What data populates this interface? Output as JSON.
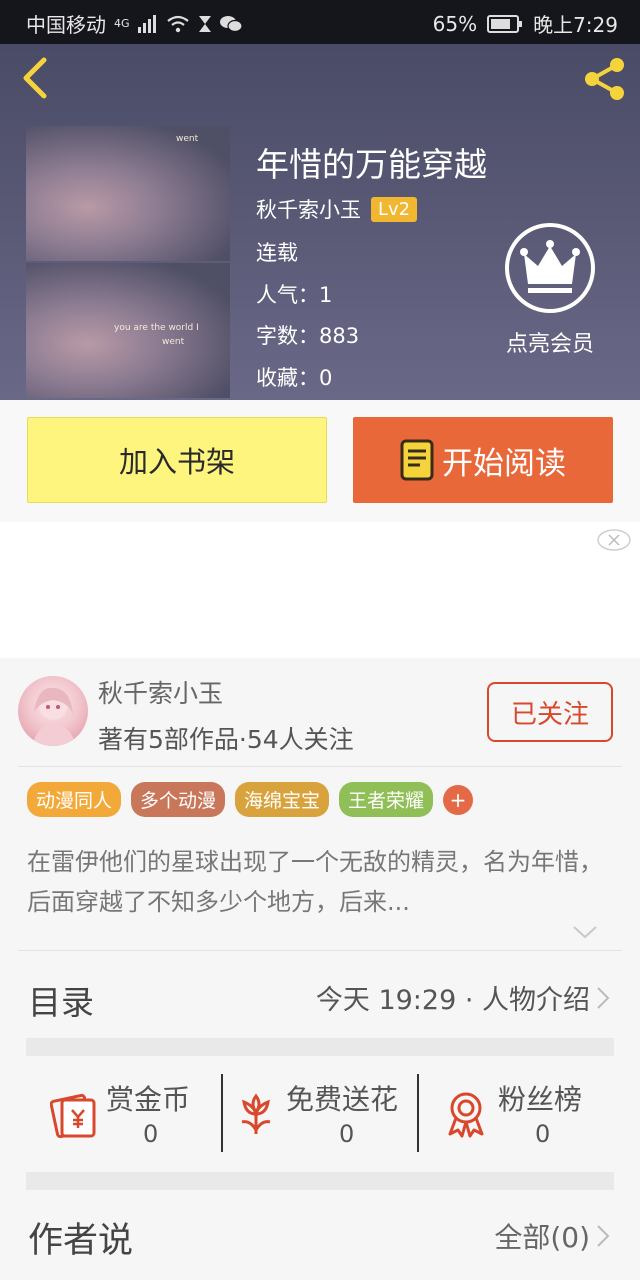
{
  "status_bar": {
    "carrier": "中国移动",
    "network": "4G",
    "battery": "65%",
    "time": "晚上7:29"
  },
  "book": {
    "title": "年惜的万能穿越",
    "author": "秋千索小玉",
    "level": "Lv2",
    "status": "连载",
    "popularity": "人气：1",
    "word_count": "字数：883",
    "favorites": "收藏：0",
    "cover_text_1": "went",
    "cover_text_2": "you are the world I",
    "cover_text_3": "went"
  },
  "vip": {
    "label": "点亮会员"
  },
  "actions": {
    "add_shelf": "加入书架",
    "start_reading": "开始阅读"
  },
  "author_card": {
    "name": "秋千索小玉",
    "stats": "著有5部作品·54人关注",
    "follow": "已关注"
  },
  "tags": {
    "items": [
      {
        "label": "动漫同人",
        "color": "#f3a93a"
      },
      {
        "label": "多个动漫",
        "color": "#c8775a"
      },
      {
        "label": "海绵宝宝",
        "color": "#d8a23c"
      },
      {
        "label": "王者荣耀",
        "color": "#8fbf56"
      }
    ],
    "plus": "+"
  },
  "description": "在雷伊他们的星球出现了一个无敌的精灵，名为年惜，后面穿越了不知多少个地方，后来...",
  "toc": {
    "title": "目录",
    "latest": "今天 19:29 · 人物介绍"
  },
  "rewards": {
    "items": [
      {
        "label": "赏金币",
        "count": "0",
        "icon": "reward-coin-icon"
      },
      {
        "label": "免费送花",
        "count": "0",
        "icon": "flower-icon"
      },
      {
        "label": "粉丝榜",
        "count": "0",
        "icon": "medal-icon"
      }
    ]
  },
  "author_says": {
    "title": "作者说",
    "all": "全部(0)"
  },
  "colors": {
    "accent_orange": "#e8683a",
    "shelf_yellow": "#fdf57e",
    "icon_yellow": "#f5d43b",
    "follow_red": "#d9482c",
    "level_badge": "#f1b730"
  }
}
